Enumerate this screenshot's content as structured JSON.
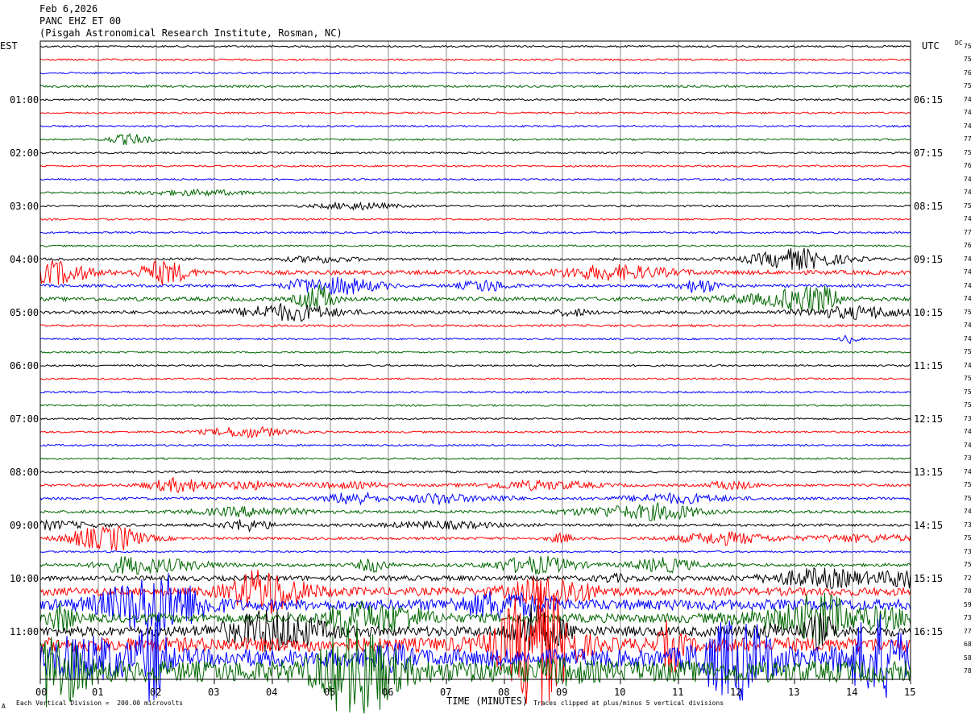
{
  "header": {
    "date": "Feb 6,2026",
    "station": "PANC EHZ ET 00",
    "location": "(Pisgah Astronomical Research Institute, Rosman, NC)"
  },
  "left_axis_label": "EST",
  "right_axis_label": "UTC",
  "dc_label": "DC",
  "footer": {
    "scale_note": "Each Vertical Division =  200.00 microvolts",
    "x_axis_title": "TIME (MINUTES)",
    "clip_note": "Traces clipped at plus/minus 5 vertical divisions",
    "corner_mark": "A"
  },
  "chart_data": {
    "type": "line",
    "title": "",
    "xlabel": "TIME (MINUTES)",
    "x_range": [
      0,
      15
    ],
    "x_ticks": [
      "00",
      "01",
      "02",
      "03",
      "04",
      "05",
      "06",
      "07",
      "08",
      "09",
      "10",
      "11",
      "12",
      "13",
      "14",
      "15"
    ],
    "row_count": 48,
    "row_colors": [
      "#000000",
      "#ff0000",
      "#0000ff",
      "#006600"
    ],
    "left_hour_labels": [
      "01:00",
      "02:00",
      "03:00",
      "04:00",
      "05:00",
      "06:00",
      "07:00",
      "08:00",
      "09:00",
      "10:00",
      "11:00"
    ],
    "right_hour_labels": [
      "06:15",
      "07:15",
      "08:15",
      "09:15",
      "10:15",
      "11:15",
      "12:15",
      "13:15",
      "14:15",
      "15:15",
      "16:15"
    ],
    "dc_offsets": [
      "75",
      "75",
      "76",
      "75",
      "74",
      "74",
      "74",
      "77",
      "75",
      "76",
      "74",
      "74",
      "75",
      "74",
      "77",
      "76",
      "74",
      "74",
      "74",
      "74",
      "75",
      "74",
      "74",
      "75",
      "74",
      "75",
      "75",
      "75",
      "73",
      "74",
      "74",
      "73",
      "74",
      "75",
      "75",
      "74",
      "73",
      "75",
      "73",
      "75",
      "72",
      "70",
      "59",
      "73",
      "77",
      "68",
      "58",
      "78"
    ],
    "activity_level": [
      1,
      1,
      1,
      1.2,
      1,
      1,
      1,
      1,
      1,
      1,
      1,
      1,
      1,
      1,
      1,
      1,
      1.4,
      2.4,
      1.6,
      2.2,
      1.8,
      1.3,
      1,
      1,
      1,
      1,
      1,
      1,
      1,
      1,
      1,
      1,
      1.2,
      1.4,
      1.5,
      1.6,
      1.5,
      1.5,
      1,
      1.8,
      2.8,
      4.5,
      6,
      5,
      5.5,
      8,
      10,
      12
    ]
  }
}
